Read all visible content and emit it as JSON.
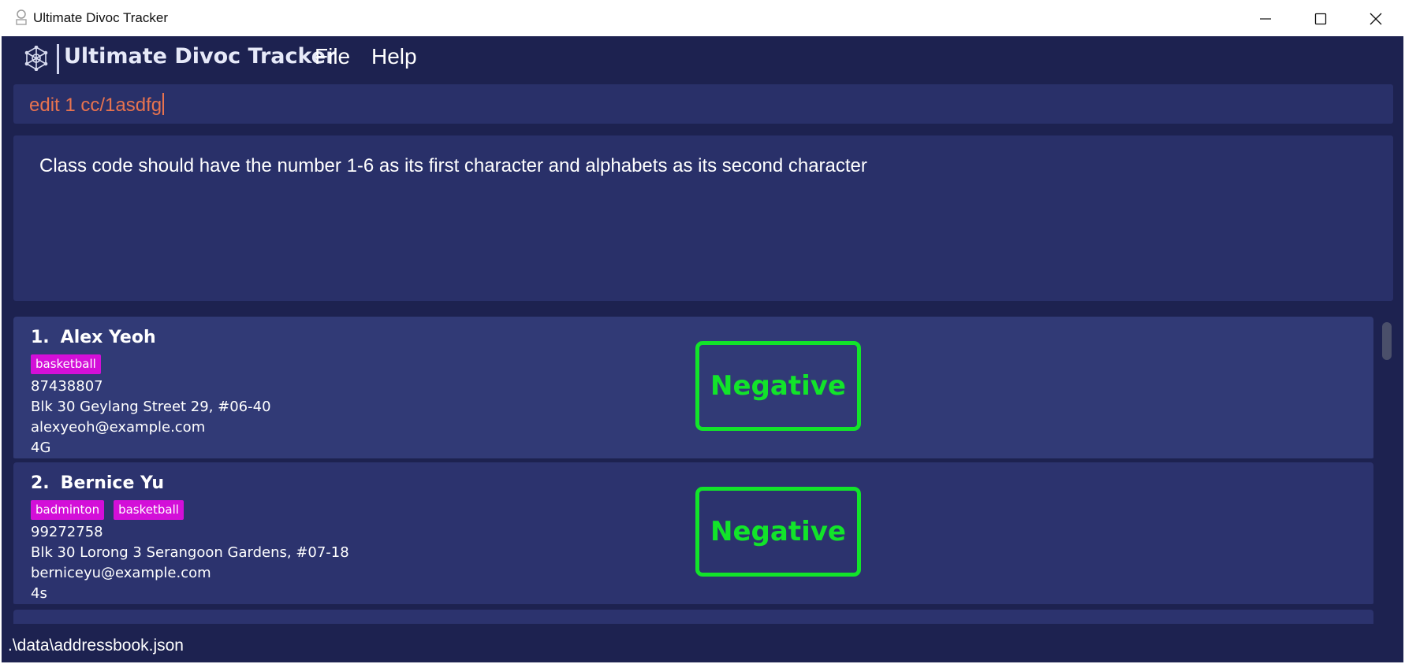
{
  "window": {
    "title": "Ultimate Divoc Tracker",
    "controls": [
      "minimize-icon",
      "maximize-icon",
      "close-icon"
    ]
  },
  "menubar": {
    "brand": "Ultimate Divoc Tracker",
    "logo_icon": "gear-molecule-icon",
    "items": [
      {
        "label": "File"
      },
      {
        "label": "Help"
      }
    ]
  },
  "command": {
    "value": "edit 1 cc/1asdfg"
  },
  "result": {
    "message": "Class code should have the number 1-6 as its first character and alphabets as its second character"
  },
  "persons": [
    {
      "index": "1.",
      "name": "Alex Yeoh",
      "tags": [
        "basketball"
      ],
      "phone": "87438807",
      "address": "Blk 30 Geylang Street 29, #06-40",
      "email": "alexyeoh@example.com",
      "class_code": "4G",
      "status": "Negative"
    },
    {
      "index": "2.",
      "name": "Bernice Yu",
      "tags": [
        "badminton",
        "basketball"
      ],
      "phone": "99272758",
      "address": "Blk 30 Lorong 3 Serangoon Gardens, #07-18",
      "email": "berniceyu@example.com",
      "class_code": "4s",
      "status": "Negative"
    }
  ],
  "statusbar": {
    "path": ".\\data\\addressbook.json"
  },
  "colors": {
    "background": "#1d2250",
    "panel": "#293069",
    "command_text": "#e8734f",
    "tag": "#d30fd8",
    "status_negative": "#12e42a"
  }
}
